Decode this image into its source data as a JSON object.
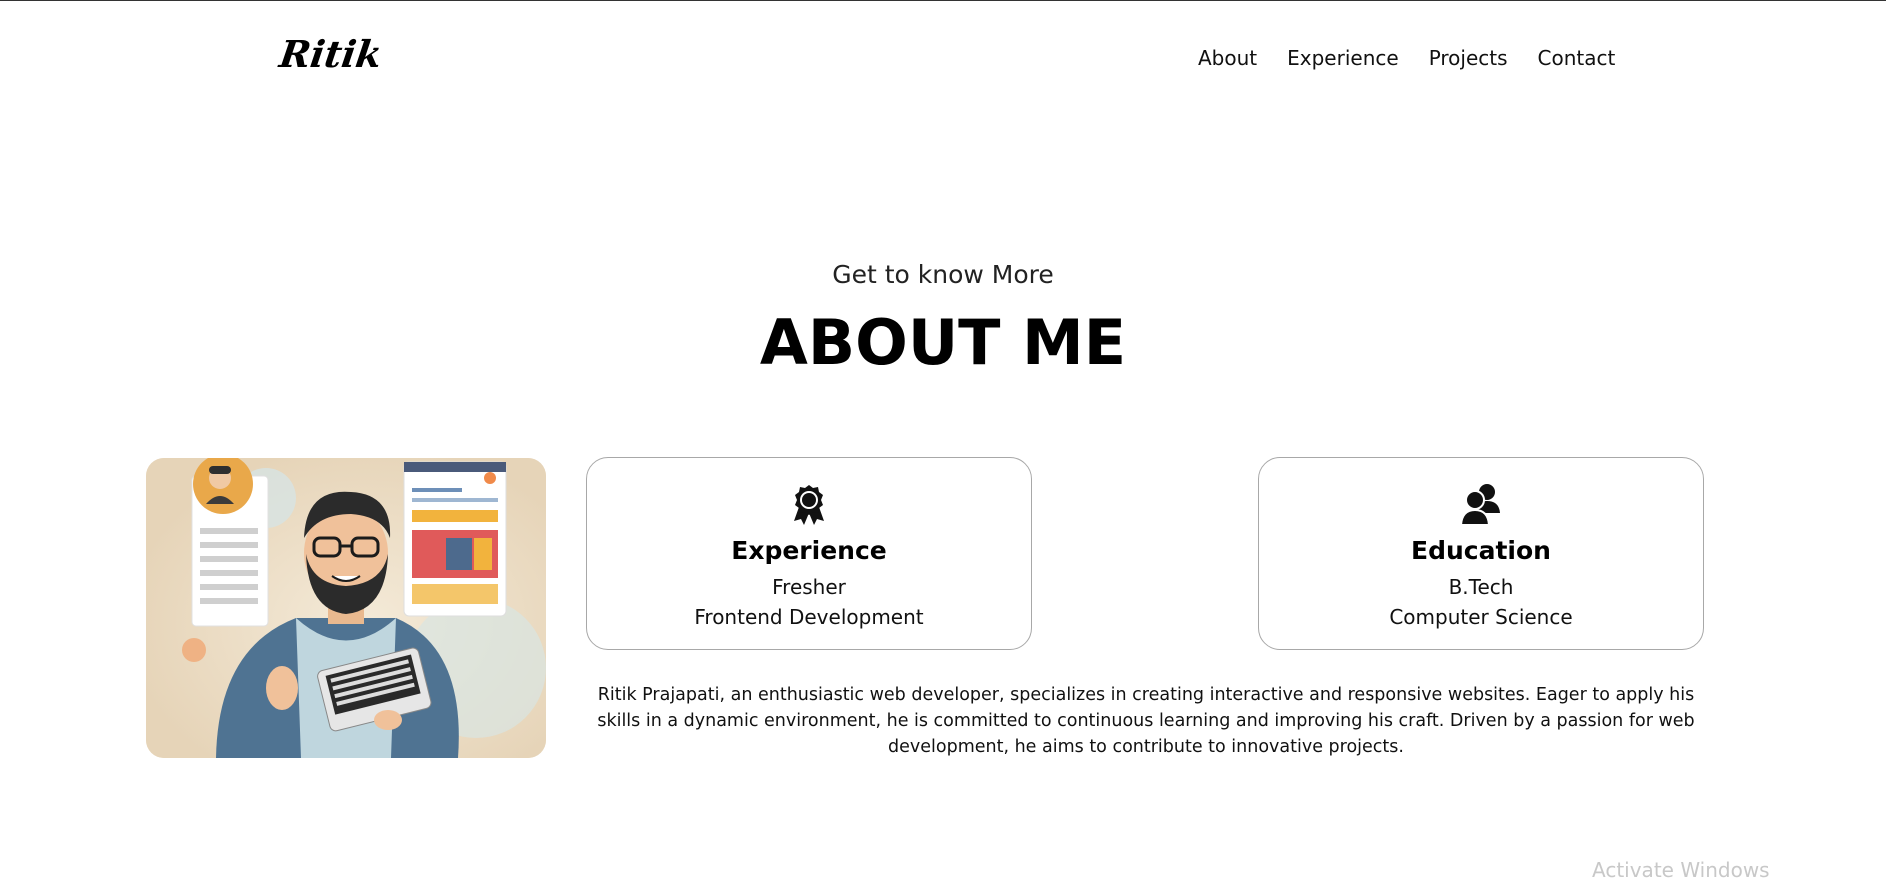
{
  "header": {
    "logo": "Ritik",
    "nav": [
      "About",
      "Experience",
      "Projects",
      "Contact"
    ]
  },
  "about": {
    "subtitle": "Get to know More",
    "title": "ABOUT ME",
    "cards": [
      {
        "icon": "award-icon",
        "title": "Experience",
        "line1": "Fresher",
        "line2": "Frontend Development"
      },
      {
        "icon": "users-icon",
        "title": "Education",
        "line1": "B.Tech",
        "line2": "Computer Science"
      }
    ],
    "bio": "Ritik Prajapati, an enthusiastic web developer, specializes in creating interactive and responsive websites. Eager to apply his skills in a dynamic environment, he is committed to continuous learning and improving his craft. Driven by a passion for web development, he aims to contribute to innovative projects."
  },
  "watermark": "Activate Windows"
}
